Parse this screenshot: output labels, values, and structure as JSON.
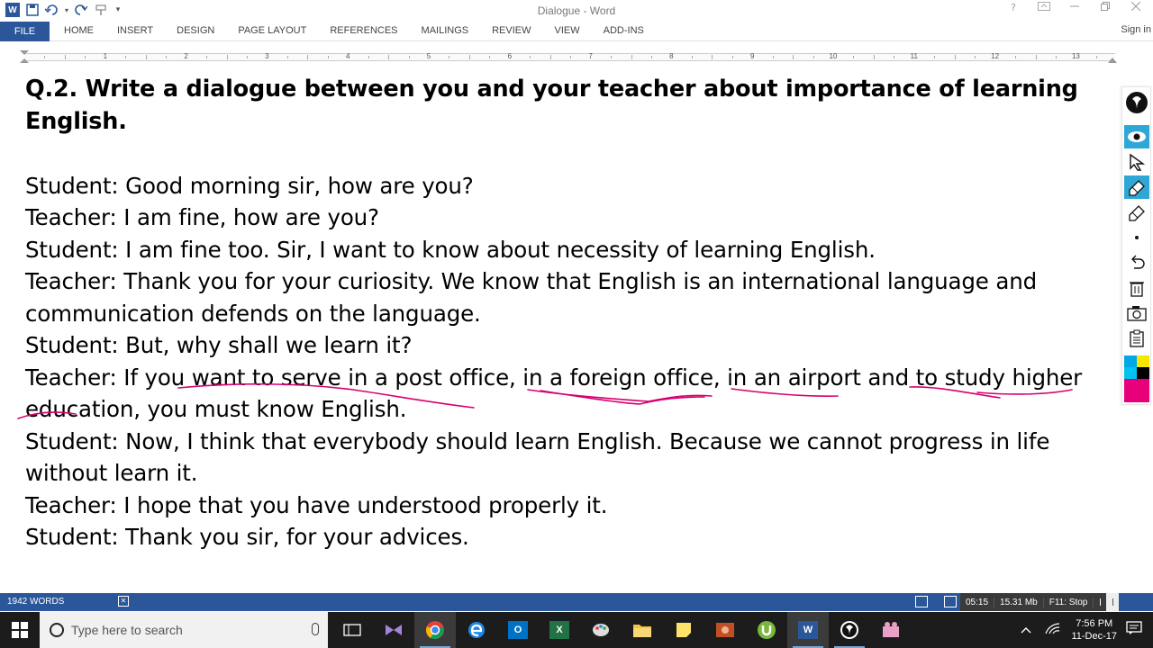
{
  "window": {
    "title": "Dialogue - Word",
    "signin": "Sign in"
  },
  "ribbon": {
    "file": "FILE",
    "tabs": [
      "HOME",
      "INSERT",
      "DESIGN",
      "PAGE LAYOUT",
      "REFERENCES",
      "MAILINGS",
      "REVIEW",
      "VIEW",
      "ADD-INS"
    ]
  },
  "ruler": {
    "numbers": [
      "1",
      "2",
      "3",
      "4",
      "5",
      "6",
      "7",
      "8",
      "9",
      "10",
      "11",
      "12",
      "13"
    ]
  },
  "document": {
    "heading": "Q.2. Write a dialogue between you and your teacher about importance of learning English.",
    "lines": [
      "Student: Good morning sir, how are you?",
      "Teacher: I am fine, how are you?",
      "Student: I am fine too. Sir, I want to know about necessity of learning English.",
      "Teacher: Thank you for your curiosity. We know that English is an international language and",
      "communication defends on the language.",
      "Student: But, why shall we learn it?",
      "Teacher: If you want to serve in a post office, in a foreign office, in an airport and to study higher",
      "education, you must know English.",
      "Student: Now, I think that everybody should learn English. Because we cannot progress in life",
      "without learn it.",
      "Teacher: I hope that you have understood properly it.",
      "Student: Thank you sir, for your advices."
    ]
  },
  "annotation_palette": [
    "#00a8e8",
    "#f7e600",
    "#00c2f0",
    "#000000",
    "#e8007a",
    "#e8007a"
  ],
  "ink_color": "#d6006f",
  "statusbar": {
    "words": "1942 WORDS",
    "rec_time": "05:15",
    "rec_size": "15.31 Mb",
    "rec_stop": "F11: Stop"
  },
  "taskbar": {
    "search_placeholder": "Type here to search",
    "time": "7:56 PM",
    "date": "11-Dec-17"
  }
}
